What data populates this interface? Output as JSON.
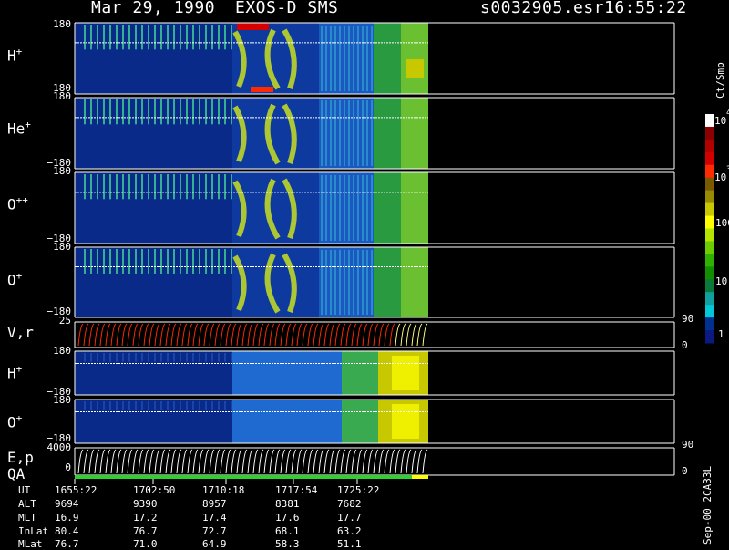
{
  "header": {
    "date": "Mar 29, 1990",
    "instrument": "EXOS-D SMS",
    "file": "s0032905.esr",
    "time": "16:55:22"
  },
  "panels": [
    {
      "id": "h1",
      "label_base": "H",
      "label_sup": "+",
      "top_tick": "180",
      "bot_tick": "−180"
    },
    {
      "id": "he",
      "label_base": "He",
      "label_sup": "+",
      "top_tick": "180",
      "bot_tick": "−180"
    },
    {
      "id": "opp",
      "label_base": "O",
      "label_sup": "++",
      "top_tick": "180",
      "bot_tick": "−180"
    },
    {
      "id": "o1",
      "label_base": "O",
      "label_sup": "+",
      "top_tick": "180",
      "bot_tick": "−180"
    },
    {
      "id": "vr",
      "label_base": "V,r",
      "label_sup": "",
      "top_tick": "25",
      "bot_tick": "0",
      "right_top": "90",
      "right_bot": "0"
    },
    {
      "id": "h2",
      "label_base": "H",
      "label_sup": "+",
      "top_tick": "180",
      "bot_tick": "−180"
    },
    {
      "id": "o2",
      "label_base": "O",
      "label_sup": "+",
      "top_tick": "180",
      "bot_tick": "−180"
    },
    {
      "id": "ep",
      "label_base": "E,p",
      "label_sup": "",
      "top_tick": "4000",
      "bot_tick": "0",
      "right_top": "90",
      "right_bot": "0"
    }
  ],
  "qa_label": "QA",
  "colorbar": {
    "units": "Ct/Smp",
    "tick_labels": [
      "10",
      "4",
      "10",
      "3",
      "100",
      "10",
      "1"
    ],
    "colors": [
      "#ffffff",
      "#8b0000",
      "#b00000",
      "#d40000",
      "#ff2a00",
      "#7a5a00",
      "#9a8a00",
      "#c8c800",
      "#ffff00",
      "#b4e400",
      "#6ccc00",
      "#30b000",
      "#109000",
      "#0a7a3a",
      "#10a0a0",
      "#00c8d8",
      "#003090",
      "#0a1a80"
    ]
  },
  "ephemeris": {
    "row_labels": [
      "UT",
      "ALT",
      "MLT",
      "InLat",
      "MLat"
    ],
    "columns": [
      [
        "1655:22",
        "9694",
        "16.9",
        "80.4",
        "76.7"
      ],
      [
        "1702:50",
        "9390",
        "17.2",
        "76.7",
        "71.0"
      ],
      [
        "1710:18",
        "8957",
        "17.4",
        "72.7",
        "64.9"
      ],
      [
        "1717:54",
        "8381",
        "17.6",
        "68.1",
        "58.3"
      ],
      [
        "1725:22",
        "7682",
        "17.7",
        "63.2",
        "51.1"
      ]
    ]
  },
  "footer_note": "Sep-00 2CA33L",
  "chart_data": {
    "type": "heatmap",
    "title": "Mar 29, 1990  EXOS-D SMS",
    "x_ticks": [
      "1655:22",
      "1702:50",
      "1710:18",
      "1717:54",
      "1725:22"
    ],
    "panels": [
      "H+",
      "He+",
      "O++",
      "O+",
      "V,r",
      "H+",
      "O+",
      "E,p"
    ],
    "pitch_angle_range": [
      -180,
      180
    ],
    "vr_range": [
      0,
      25
    ],
    "ep_range": [
      0,
      4000
    ],
    "colorbar_range": [
      1,
      10000
    ],
    "colorbar_scale": "log",
    "colorbar_units": "Ct/Smp"
  }
}
